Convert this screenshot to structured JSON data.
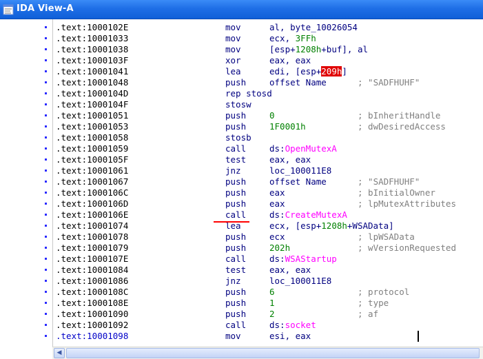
{
  "window": {
    "title": "IDA View-A"
  },
  "listing": [
    {
      "addr": ".text:1000102E",
      "mn": "mov",
      "op": [
        {
          "t": "al, byte_10026054",
          "c": "pl"
        }
      ],
      "cm": ""
    },
    {
      "addr": ".text:10001033",
      "mn": "mov",
      "op": [
        {
          "t": "ecx, ",
          "c": "pl"
        },
        {
          "t": "3FFh",
          "c": "num"
        }
      ],
      "cm": ""
    },
    {
      "addr": ".text:10001038",
      "mn": "mov",
      "op": [
        {
          "t": "[esp+",
          "c": "pl"
        },
        {
          "t": "1208h",
          "c": "num"
        },
        {
          "t": "+buf], al",
          "c": "pl"
        }
      ],
      "cm": ""
    },
    {
      "addr": ".text:1000103F",
      "mn": "xor",
      "op": [
        {
          "t": "eax, eax",
          "c": "pl"
        }
      ],
      "cm": ""
    },
    {
      "addr": ".text:10001041",
      "mn": "lea",
      "op": [
        {
          "t": "edi, [esp+",
          "c": "pl"
        },
        {
          "t": "209h",
          "c": "hl"
        },
        {
          "t": "]",
          "c": "pl"
        }
      ],
      "cm": ""
    },
    {
      "addr": ".text:10001048",
      "mn": "push",
      "op": [
        {
          "t": "offset Name",
          "c": "pl"
        }
      ],
      "cm": "; \"SADFHUHF\""
    },
    {
      "addr": ".text:1000104D",
      "mn": "rep stosd",
      "op": [],
      "cm": ""
    },
    {
      "addr": ".text:1000104F",
      "mn": "stosw",
      "op": [],
      "cm": ""
    },
    {
      "addr": ".text:10001051",
      "mn": "push",
      "op": [
        {
          "t": "0",
          "c": "num"
        }
      ],
      "cm": "; bInheritHandle"
    },
    {
      "addr": ".text:10001053",
      "mn": "push",
      "op": [
        {
          "t": "1F0001h",
          "c": "num"
        }
      ],
      "cm": "; dwDesiredAccess"
    },
    {
      "addr": ".text:10001058",
      "mn": "stosb",
      "op": [],
      "cm": ""
    },
    {
      "addr": ".text:10001059",
      "mn": "call",
      "op": [
        {
          "t": "ds:",
          "c": "pl"
        },
        {
          "t": "OpenMutexA",
          "c": "imp"
        }
      ],
      "cm": ""
    },
    {
      "addr": ".text:1000105F",
      "mn": "test",
      "op": [
        {
          "t": "eax, eax",
          "c": "pl"
        }
      ],
      "cm": ""
    },
    {
      "addr": ".text:10001061",
      "mn": "jnz",
      "op": [
        {
          "t": "loc_100011E8",
          "c": "pl"
        }
      ],
      "cm": ""
    },
    {
      "addr": ".text:10001067",
      "mn": "push",
      "op": [
        {
          "t": "offset Name",
          "c": "pl"
        }
      ],
      "cm": "; \"SADFHUHF\""
    },
    {
      "addr": ".text:1000106C",
      "mn": "push",
      "op": [
        {
          "t": "eax",
          "c": "pl"
        }
      ],
      "cm": "; bInitialOwner"
    },
    {
      "addr": ".text:1000106D",
      "mn": "push",
      "op": [
        {
          "t": "eax",
          "c": "pl"
        }
      ],
      "cm": "; lpMutexAttributes"
    },
    {
      "addr": ".text:1000106E",
      "mn": "call",
      "op": [
        {
          "t": "ds:",
          "c": "pl"
        },
        {
          "t": "CreateMutexA",
          "c": "imp"
        }
      ],
      "cm": ""
    },
    {
      "addr": ".text:10001074",
      "mn": "lea",
      "op": [
        {
          "t": "ecx, [esp+",
          "c": "pl"
        },
        {
          "t": "1208h",
          "c": "num"
        },
        {
          "t": "+WSAData]",
          "c": "pl"
        }
      ],
      "cm": ""
    },
    {
      "addr": ".text:10001078",
      "mn": "push",
      "op": [
        {
          "t": "ecx",
          "c": "pl"
        }
      ],
      "cm": "; lpWSAData"
    },
    {
      "addr": ".text:10001079",
      "mn": "push",
      "op": [
        {
          "t": "202h",
          "c": "num"
        }
      ],
      "cm": "; wVersionRequested"
    },
    {
      "addr": ".text:1000107E",
      "mn": "call",
      "op": [
        {
          "t": "ds:",
          "c": "pl"
        },
        {
          "t": "WSAStartup",
          "c": "imp"
        }
      ],
      "cm": ""
    },
    {
      "addr": ".text:10001084",
      "mn": "test",
      "op": [
        {
          "t": "eax, eax",
          "c": "pl"
        }
      ],
      "cm": ""
    },
    {
      "addr": ".text:10001086",
      "mn": "jnz",
      "op": [
        {
          "t": "loc_100011E8",
          "c": "pl"
        }
      ],
      "cm": ""
    },
    {
      "addr": ".text:1000108C",
      "mn": "push",
      "op": [
        {
          "t": "6",
          "c": "num"
        }
      ],
      "cm": "; protocol"
    },
    {
      "addr": ".text:1000108E",
      "mn": "push",
      "op": [
        {
          "t": "1",
          "c": "num"
        }
      ],
      "cm": "; type"
    },
    {
      "addr": ".text:10001090",
      "mn": "push",
      "op": [
        {
          "t": "2",
          "c": "num"
        }
      ],
      "cm": "; af"
    },
    {
      "addr": ".text:10001092",
      "mn": "call",
      "op": [
        {
          "t": "ds:",
          "c": "pl"
        },
        {
          "t": "socket",
          "c": "imp"
        }
      ],
      "cm": ""
    },
    {
      "addr": ".text:10001098",
      "mn": "mov",
      "op": [
        {
          "t": "esi, eax",
          "c": "pl"
        }
      ],
      "cm": "",
      "current": true
    }
  ],
  "icons": {
    "window": "ida-view-icon",
    "scroll_left": "scroll-left-arrow-icon"
  },
  "colors": {
    "titlebar": "#1f6fe6",
    "mnemonic": "#000080",
    "number": "#008000",
    "import": "#ff00ff",
    "comment": "#7f7f7f",
    "highlight": "#e00000",
    "annotation": "#ff0000",
    "current_address": "#0000c8"
  }
}
